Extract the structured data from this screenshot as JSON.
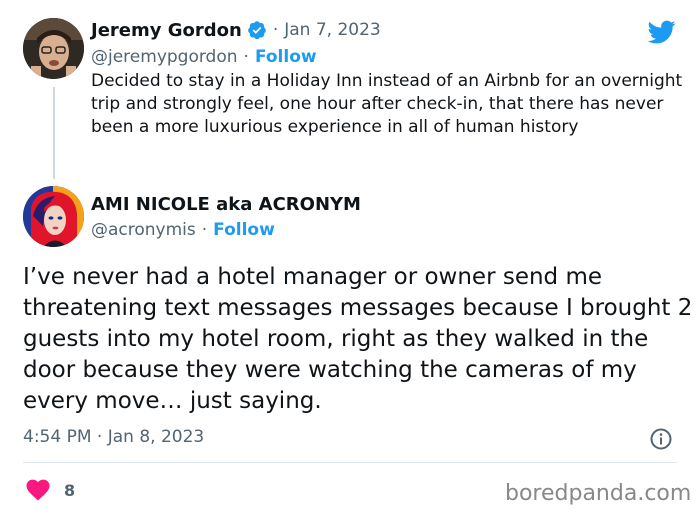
{
  "tweet_original": {
    "author_name": "Jeremy Gordon",
    "date": "Jan 7, 2023",
    "handle": "@jeremypgordon",
    "follow_label": "Follow",
    "text": "Decided to stay in a Holiday Inn instead of an Airbnb for an overnight trip and strongly feel, one hour after check-in, that there has never been a more luxurious experience in all of human history"
  },
  "tweet_reply": {
    "author_name": "AMI NICOLE aka ACRONYM",
    "handle": "@acronymis",
    "follow_label": "Follow",
    "text": "I’ve never had a hotel manager or owner send me threatening text messages messages because I brought 2 guests into my hotel room, right as they walked in the door because they were watching the cameras of my every move… just saying.",
    "timestamp": "4:54 PM · Jan 8, 2023",
    "like_count": "8"
  },
  "separator": "·",
  "watermark": "boredpanda.com",
  "colors": {
    "twitter_blue": "#1d9bf0",
    "secondary_text": "#536471",
    "like_heart": "#f91880"
  },
  "icons": {
    "brand": "twitter-bird-icon",
    "verified": "verified-badge-icon",
    "info": "info-icon",
    "like": "heart-icon"
  }
}
